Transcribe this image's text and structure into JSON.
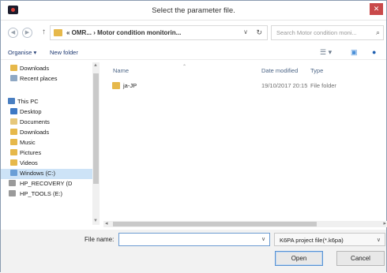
{
  "window": {
    "title": "Select the parameter file.",
    "close_glyph": "✕"
  },
  "nav_buttons": {
    "back_glyph": "◀",
    "forward_glyph": "▶",
    "up_glyph": "↑"
  },
  "address": {
    "path": "« OMR... › Motor condition monitorin...",
    "chevron": "∨",
    "refresh_glyph": "↻"
  },
  "search": {
    "placeholder": "Search Motor condition moni...",
    "icon": "search-icon"
  },
  "command_bar": {
    "organise_label": "Organise ▾",
    "new_folder_label": "New folder"
  },
  "nav_pane": {
    "items": [
      {
        "label": "Downloads",
        "icon": "downloads-icon",
        "color": "#e6b84a"
      },
      {
        "label": "Recent places",
        "icon": "recent-places-icon",
        "color": "#8fa8c4"
      },
      {
        "label": "This PC",
        "icon": "this-pc-icon",
        "color": "#4a7fc1"
      },
      {
        "label": "Desktop",
        "icon": "desktop-icon",
        "color": "#3d78c4"
      },
      {
        "label": "Documents",
        "icon": "documents-icon",
        "color": "#e6c77a"
      },
      {
        "label": "Downloads",
        "icon": "downloads-icon",
        "color": "#e6b84a"
      },
      {
        "label": "Music",
        "icon": "music-icon",
        "color": "#e6b84a"
      },
      {
        "label": "Pictures",
        "icon": "pictures-icon",
        "color": "#e6b84a"
      },
      {
        "label": "Videos",
        "icon": "videos-icon",
        "color": "#e6b84a"
      },
      {
        "label": "Windows (C:)",
        "icon": "drive-c-icon",
        "color": "#6a9ed6"
      },
      {
        "label": "HP_RECOVERY (D",
        "icon": "drive-icon",
        "color": "#9a9a9a"
      },
      {
        "label": "HP_TOOLS (E:)",
        "icon": "drive-icon",
        "color": "#9a9a9a"
      }
    ]
  },
  "file_list": {
    "columns": {
      "name": "Name",
      "date": "Date modified",
      "type": "Type"
    },
    "rows": [
      {
        "name": "ja-JP",
        "date": "19/10/2017 20:15",
        "type": "File folder"
      }
    ]
  },
  "bottom": {
    "file_name_label": "File name:",
    "file_name_value": "",
    "filter_label": "K6PA project file(*.k6pa)",
    "open_label": "Open",
    "cancel_label": "Cancel"
  }
}
